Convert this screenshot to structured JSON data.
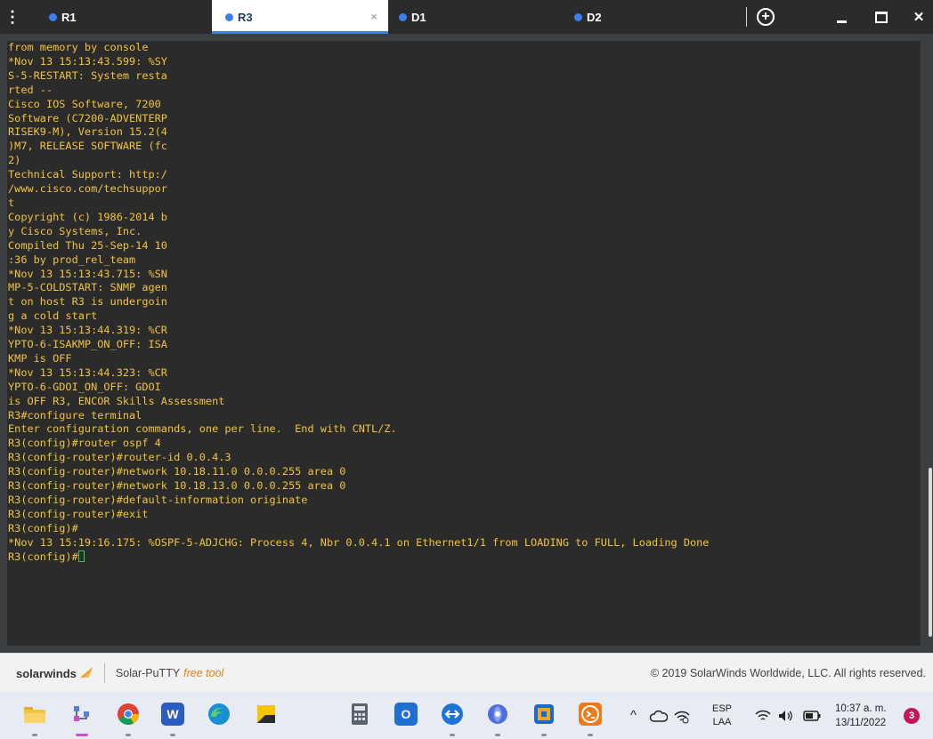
{
  "menu": {
    "icon": "vertical-dots-icon",
    "glyph": "⋮"
  },
  "tabs": [
    {
      "label": "R1",
      "active": false
    },
    {
      "label": "R3",
      "active": true,
      "close_glyph": "×"
    },
    {
      "label": "D1",
      "active": false
    },
    {
      "label": "D2",
      "active": false
    }
  ],
  "window": {
    "new_tab_glyph": "+",
    "close_glyph": "✕"
  },
  "colors": {
    "terminal_bg": "#2b2b2b",
    "terminal_text": "#f0c33c",
    "cursor": "#2bd24b",
    "tab_dot": "#3d7df2",
    "titlebar": "#2b2b2b"
  },
  "terminal": {
    "lines": [
      "from memory by console",
      "*Nov 13 15:13:43.599: %SY",
      "S-5-RESTART: System resta",
      "rted --",
      "Cisco IOS Software, 7200",
      "Software (C7200-ADVENTERP",
      "RISEK9-M), Version 15.2(4",
      ")M7, RELEASE SOFTWARE (fc",
      "2)",
      "Technical Support: http:/",
      "/www.cisco.com/techsuppor",
      "t",
      "Copyright (c) 1986-2014 b",
      "y Cisco Systems, Inc.",
      "Compiled Thu 25-Sep-14 10",
      ":36 by prod_rel_team",
      "*Nov 13 15:13:43.715: %SN",
      "MP-5-COLDSTART: SNMP agen",
      "t on host R3 is undergoin",
      "g a cold start",
      "*Nov 13 15:13:44.319: %CR",
      "YPTO-6-ISAKMP_ON_OFF: ISA",
      "KMP is OFF",
      "*Nov 13 15:13:44.323: %CR",
      "YPTO-6-GDOI_ON_OFF: GDOI",
      "is OFF R3, ENCOR Skills Assessment",
      "R3#configure terminal",
      "Enter configuration commands, one per line.  End with CNTL/Z.",
      "R3(config)#router ospf 4",
      "R3(config-router)#router-id 0.0.4.3",
      "R3(config-router)#network 10.18.11.0 0.0.0.255 area 0",
      "R3(config-router)#network 10.18.13.0 0.0.0.255 area 0",
      "R3(config-router)#default-information originate",
      "R3(config-router)#exit",
      "R3(config)#",
      "*Nov 13 15:19:16.175: %OSPF-5-ADJCHG: Process 4, Nbr 0.0.4.1 on Ethernet1/1 from LOADING to FULL, Loading Done"
    ],
    "prompt": "R3(config)#"
  },
  "footer": {
    "brand": "solarwinds",
    "brand_icon": "solarwinds-flame-icon",
    "product": "Solar-PuTTY",
    "free_tool": "free tool",
    "copyright": "© 2019 SolarWinds Worldwide, LLC. All rights reserved."
  },
  "taskbar": {
    "apps": [
      {
        "name": "file-explorer-icon"
      },
      {
        "name": "git-app-icon"
      },
      {
        "name": "chrome-icon"
      },
      {
        "name": "word-icon",
        "glyph": "W"
      },
      {
        "name": "edge-icon"
      },
      {
        "name": "sticky-notes-icon"
      },
      {
        "name": "calculator-icon"
      },
      {
        "name": "outlook-icon",
        "glyph": "O"
      },
      {
        "name": "remote-desktop-icon"
      },
      {
        "name": "gns3-icon"
      },
      {
        "name": "virtualbox-icon"
      },
      {
        "name": "solar-putty-icon"
      }
    ],
    "tray": {
      "chevron": "^",
      "lang_top": "ESP",
      "lang_bottom": "LAA",
      "time": "10:37 a. m.",
      "date": "13/11/2022",
      "notifications": "3"
    }
  }
}
